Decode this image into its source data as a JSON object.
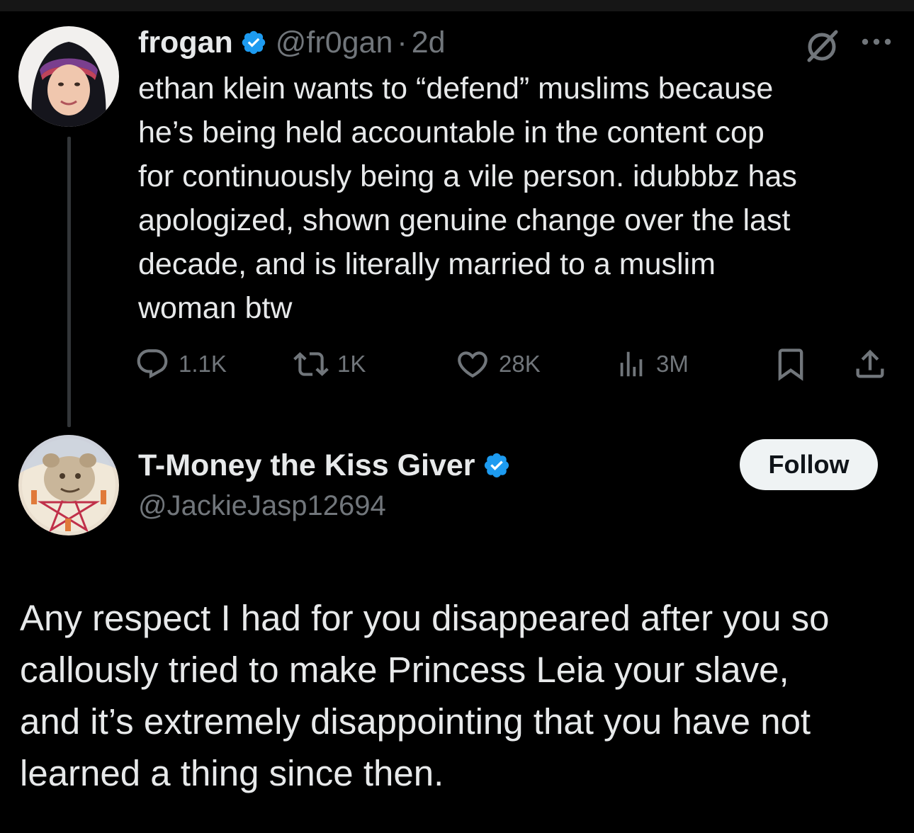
{
  "parent_tweet": {
    "author": {
      "display_name": "frogan",
      "handle": "@fr0gan",
      "verified": true
    },
    "time": "2d",
    "separator": "·",
    "text_lines": [
      "ethan klein wants to “defend” muslims  because",
      "he’s being held accountable in the content cop",
      "for continuously being a vile person. idubbbz has",
      "apologized, shown genuine change over the last",
      "decade, and is literally married to a muslim",
      "woman btw"
    ],
    "metrics": {
      "replies": "1.1K",
      "retweets": "1K",
      "likes": "28K",
      "views": "3M"
    },
    "icons": {
      "grok": "grok-icon",
      "more": "more-options-icon",
      "reply": "reply-icon",
      "retweet": "retweet-icon",
      "like": "heart-icon",
      "views": "views-icon",
      "bookmark": "bookmark-icon",
      "share": "share-icon"
    }
  },
  "reply_tweet": {
    "author": {
      "display_name": "T-Money the Kiss Giver",
      "handle": "@JackieJasp12694",
      "verified": true
    },
    "follow_label": "Follow",
    "text_lines": [
      "Any respect I had for you disappeared after you so",
      "callously tried to make Princess Leia your slave,",
      "and it’s extremely disappointing that you have not",
      "learned a thing since then."
    ]
  },
  "colors": {
    "background": "#000000",
    "text_primary": "#e7e9ea",
    "text_secondary": "#71767b",
    "verified_blue": "#1d9bf0",
    "thread_line": "#333639",
    "follow_bg": "#eff3f4"
  }
}
